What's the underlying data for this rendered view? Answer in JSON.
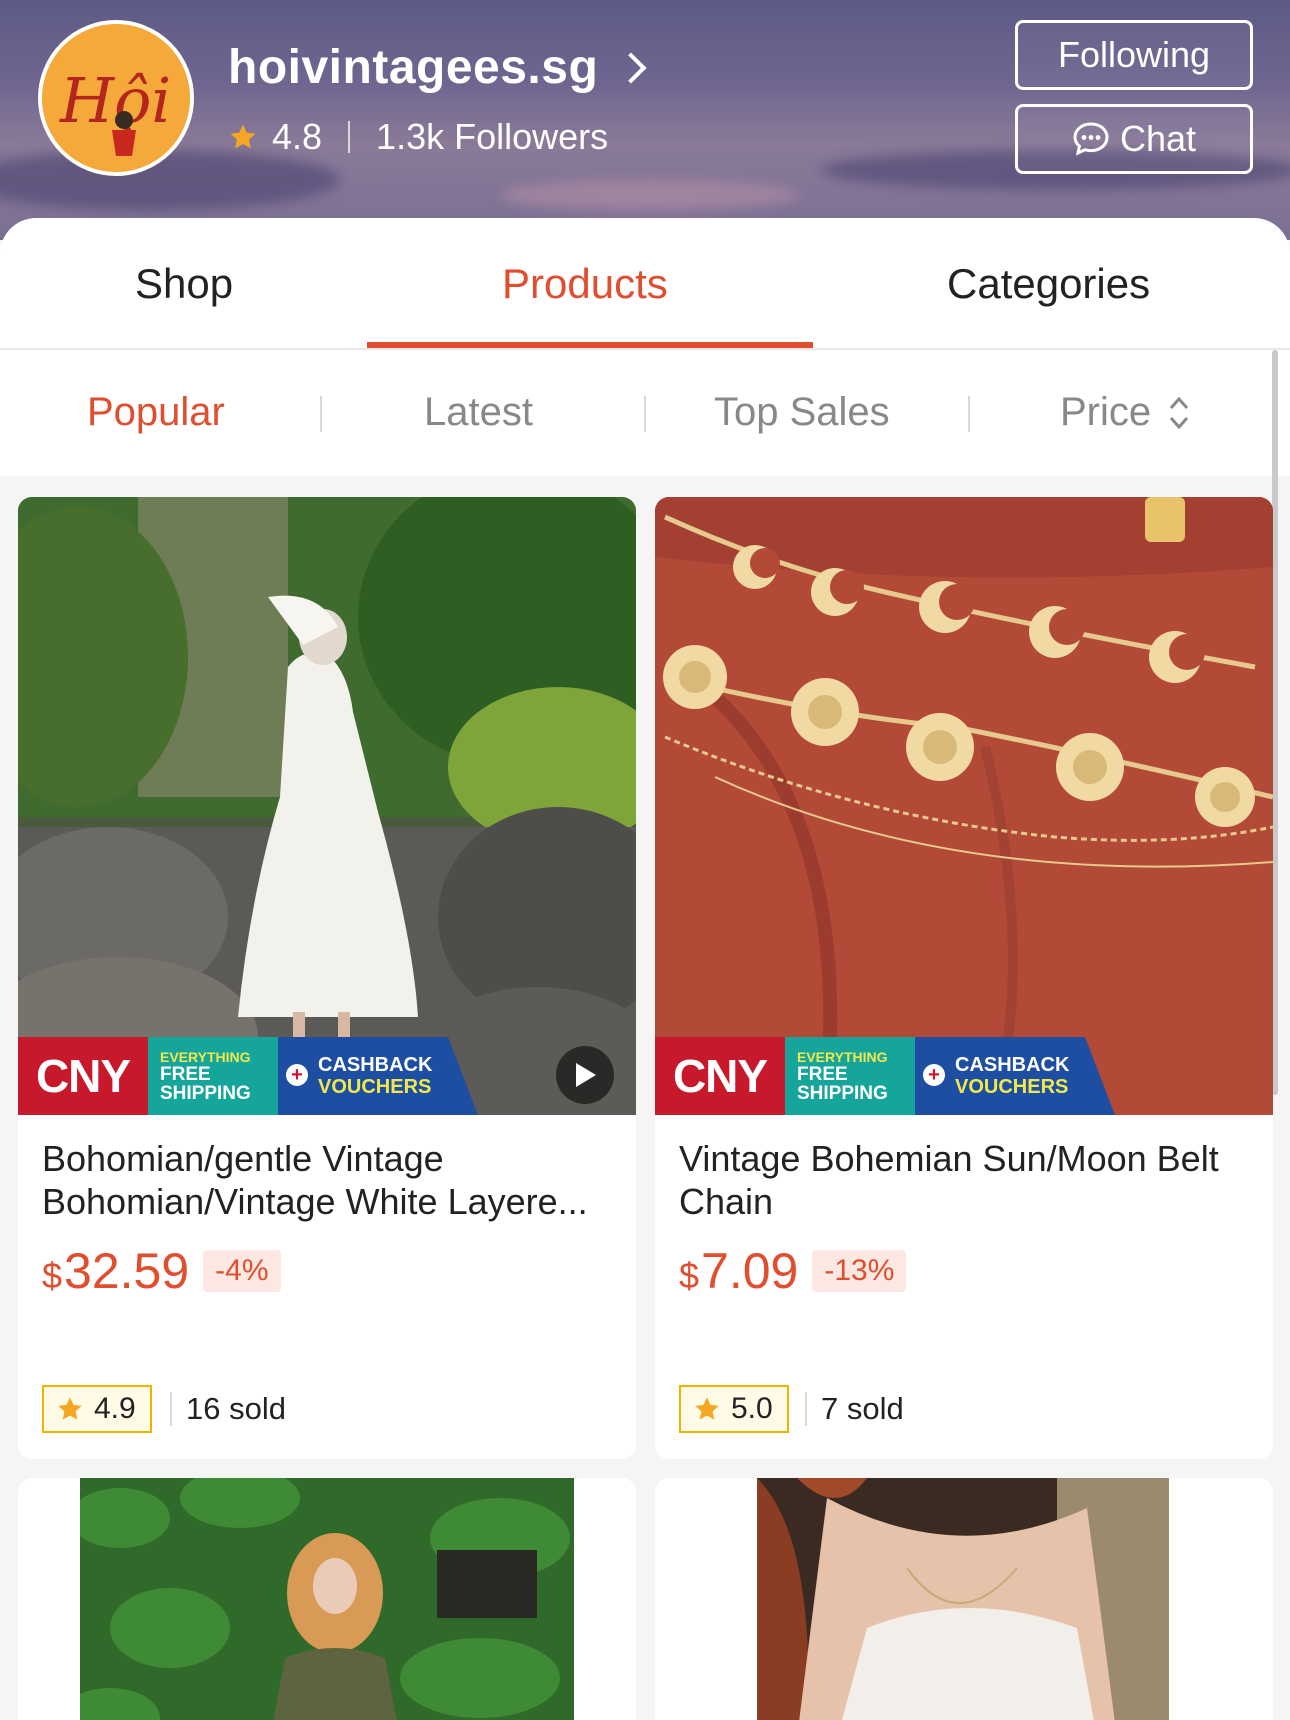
{
  "shop": {
    "name": "hoivintagees.sg",
    "rating": "4.8",
    "followers": "1.3k Followers",
    "avatar_text": "Hội"
  },
  "header_buttons": {
    "following": "Following",
    "chat": "Chat"
  },
  "tabs": [
    {
      "label": "Shop",
      "active": false
    },
    {
      "label": "Products",
      "active": true
    },
    {
      "label": "Categories",
      "active": false
    }
  ],
  "sort": [
    {
      "label": "Popular",
      "active": true
    },
    {
      "label": "Latest",
      "active": false
    },
    {
      "label": "Top Sales",
      "active": false
    },
    {
      "label": "Price",
      "active": false
    }
  ],
  "banner": {
    "cny": "CNY",
    "everything": "EVERYTHING",
    "free": "FREE",
    "shipping": "SHIPPING",
    "cashback": "CASHBACK",
    "vouchers": "VOUCHERS"
  },
  "products": [
    {
      "title_line1": "Bohomian/gentle Vintage",
      "title_line2": "Bohomian/Vintage White Layere...",
      "currency": "$",
      "price": "32.59",
      "discount": "-4%",
      "rating": "4.9",
      "sold": "16 sold"
    },
    {
      "title_line1": "Vintage Bohemian Sun/Moon Belt",
      "title_line2": "Chain",
      "currency": "$",
      "price": "7.09",
      "discount": "-13%",
      "rating": "5.0",
      "sold": "7 sold"
    }
  ],
  "colors": {
    "accent": "#e04e2f",
    "star": "#f5a623",
    "cny_red": "#c8192c",
    "teal": "#16a59a",
    "navy": "#1d4ea1"
  }
}
